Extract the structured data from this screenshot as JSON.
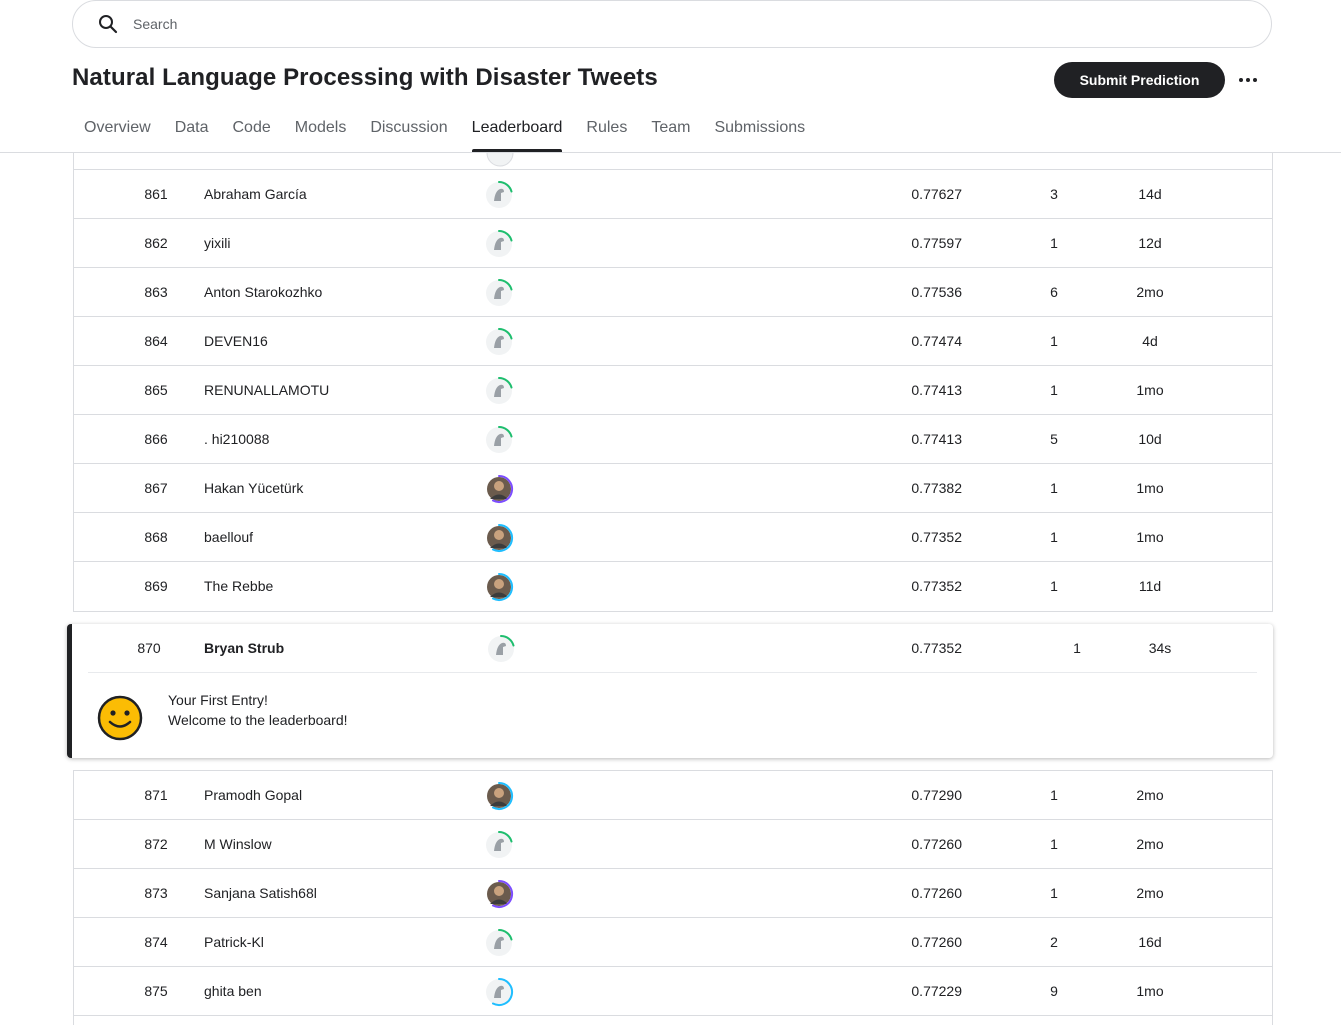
{
  "search": {
    "placeholder": "Search"
  },
  "header": {
    "title": "Natural Language Processing with Disaster Tweets",
    "submit_label": "Submit Prediction"
  },
  "tabs": [
    {
      "label": "Overview"
    },
    {
      "label": "Data"
    },
    {
      "label": "Code"
    },
    {
      "label": "Models"
    },
    {
      "label": "Discussion"
    },
    {
      "label": "Leaderboard",
      "active": true
    },
    {
      "label": "Rules"
    },
    {
      "label": "Team"
    },
    {
      "label": "Submissions"
    }
  ],
  "rows_top": [
    {
      "rank": "861",
      "name": "Abraham García",
      "score": "0.77627",
      "entries": "3",
      "last": "14d",
      "avatar": "default",
      "ring": "green"
    },
    {
      "rank": "862",
      "name": "yixili",
      "score": "0.77597",
      "entries": "1",
      "last": "12d",
      "avatar": "default",
      "ring": "green"
    },
    {
      "rank": "863",
      "name": "Anton Starokozhko",
      "score": "0.77536",
      "entries": "6",
      "last": "2mo",
      "avatar": "default",
      "ring": "green"
    },
    {
      "rank": "864",
      "name": "DEVEN16",
      "score": "0.77474",
      "entries": "1",
      "last": "4d",
      "avatar": "default",
      "ring": "green"
    },
    {
      "rank": "865",
      "name": "RENUNALLAMOTU",
      "score": "0.77413",
      "entries": "1",
      "last": "1mo",
      "avatar": "default",
      "ring": "green"
    },
    {
      "rank": "866",
      "name": ". hi210088",
      "score": "0.77413",
      "entries": "5",
      "last": "10d",
      "avatar": "default",
      "ring": "green"
    },
    {
      "rank": "867",
      "name": "Hakan Yücetürk",
      "score": "0.77382",
      "entries": "1",
      "last": "1mo",
      "avatar": "photo",
      "ring": "purple"
    },
    {
      "rank": "868",
      "name": "baellouf",
      "score": "0.77352",
      "entries": "1",
      "last": "1mo",
      "avatar": "photo",
      "ring": "blue"
    },
    {
      "rank": "869",
      "name": "The Rebbe",
      "score": "0.77352",
      "entries": "1",
      "last": "11d",
      "avatar": "photo",
      "ring": "blue"
    }
  ],
  "highlight": {
    "rank": "870",
    "name": "Bryan Strub",
    "score": "0.77352",
    "entries": "1",
    "last": "34s",
    "message_line1": "Your First Entry!",
    "message_line2": "Welcome to the leaderboard!"
  },
  "rows_bottom": [
    {
      "rank": "871",
      "name": "Pramodh Gopal",
      "score": "0.77290",
      "entries": "1",
      "last": "2mo",
      "avatar": "photo",
      "ring": "blue"
    },
    {
      "rank": "872",
      "name": "M Winslow",
      "score": "0.77260",
      "entries": "1",
      "last": "2mo",
      "avatar": "default",
      "ring": "green"
    },
    {
      "rank": "873",
      "name": "Sanjana Satish68l",
      "score": "0.77260",
      "entries": "1",
      "last": "2mo",
      "avatar": "photo",
      "ring": "purple"
    },
    {
      "rank": "874",
      "name": "Patrick-Kl",
      "score": "0.77260",
      "entries": "2",
      "last": "16d",
      "avatar": "default",
      "ring": "green"
    },
    {
      "rank": "875",
      "name": "ghita ben",
      "score": "0.77229",
      "entries": "9",
      "last": "1mo",
      "avatar": "default",
      "ring": "blue"
    }
  ],
  "colors": {
    "ring_green": "#20BEFF00",
    "green": "#1EBE6E",
    "blue": "#20BEFF",
    "purple": "#7C4DFF",
    "primary_dark": "#202124",
    "smiley": "#FBBC04"
  }
}
